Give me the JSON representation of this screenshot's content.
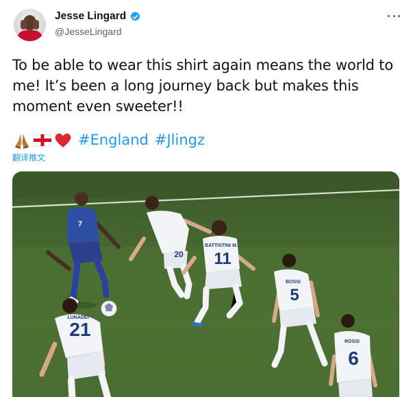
{
  "tweet": {
    "author": {
      "display_name": "Jesse Lingard",
      "handle": "@JesseLingard",
      "verified": true
    },
    "text": "To be able to wear this shirt again means the world to me! It’s been a long journey back but makes this moment even sweeter!!",
    "emojis": [
      "folded-hands",
      "england-flag",
      "red-heart"
    ],
    "hashtags": [
      "#England",
      "#Jlingz"
    ],
    "translate_label": "翻译推文"
  },
  "photo": {
    "players": [
      {
        "shirt_name": "",
        "number": "7"
      },
      {
        "shirt_name": "",
        "number": "20"
      },
      {
        "shirt_name": "BATTISTINI M.",
        "number": "11"
      },
      {
        "shirt_name": "BOSSI",
        "number": "5"
      },
      {
        "shirt_name": "LUNADEI",
        "number": "21"
      },
      {
        "shirt_name": "ROSSI",
        "number": "6"
      }
    ]
  },
  "colors": {
    "accent": "#1d9bf0",
    "text": "#0f1419",
    "muted": "#536471",
    "pitch": "#46692f",
    "england_kit": "#2f4fa5",
    "opponent_kit": "#f2f4f7"
  }
}
